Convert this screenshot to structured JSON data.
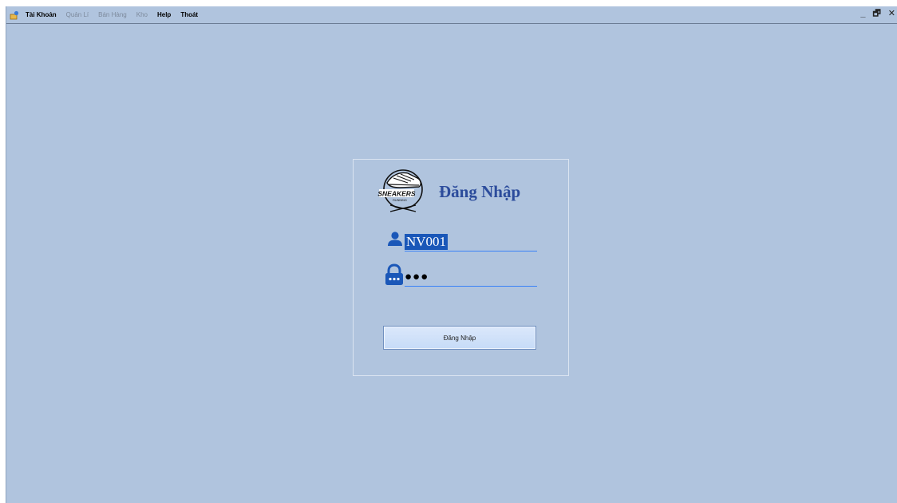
{
  "menubar": {
    "items": [
      {
        "label": "Tài Khoản",
        "enabled": true
      },
      {
        "label": "Quản Lí",
        "enabled": false
      },
      {
        "label": "Bán Hàng",
        "enabled": false
      },
      {
        "label": "Kho",
        "enabled": false
      },
      {
        "label": "Help",
        "enabled": true
      },
      {
        "label": "Thoát",
        "enabled": true
      }
    ]
  },
  "window_controls": {
    "minimize": "_",
    "restore": "🗗",
    "close": "✕"
  },
  "login": {
    "title": "Đăng Nhập",
    "logo_text_main": "SNEAKERS",
    "logo_text_sub": "RUNNING",
    "username_value": "NV001",
    "password_mask": "●●●",
    "button_label": "Đăng Nhập"
  },
  "colors": {
    "background": "#b0c4de",
    "title": "#2c4c9c",
    "icon": "#1a57b8",
    "selection": "#1a57b8",
    "underline": "#3b82f6"
  }
}
